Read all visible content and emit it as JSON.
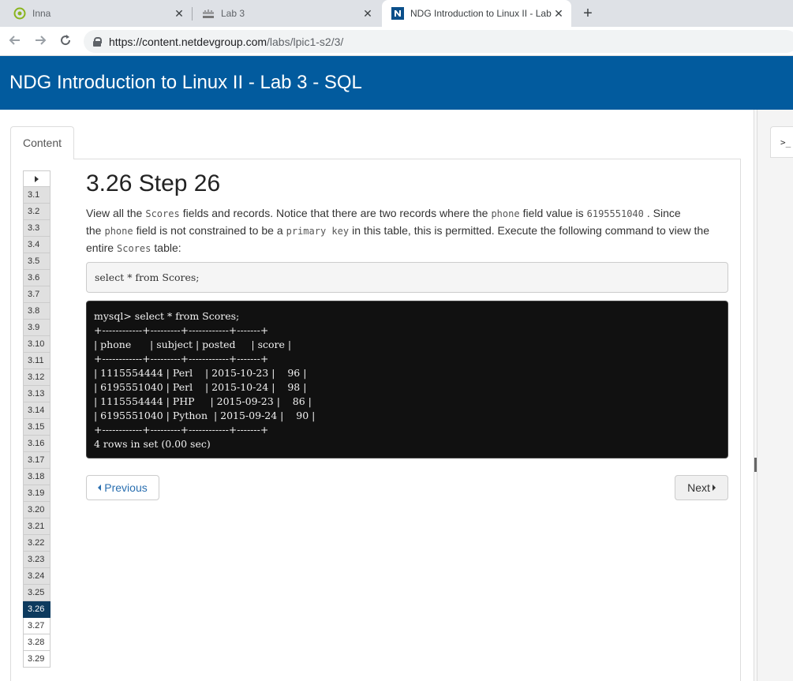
{
  "browser": {
    "tabs": [
      {
        "title": "Inna",
        "icon": "circle-target-icon"
      },
      {
        "title": "Lab 3",
        "icon": "cisco-icon"
      },
      {
        "title": "NDG Introduction to Linux II - Lab",
        "icon": "ndg-n-icon",
        "active": true
      }
    ],
    "close_glyph": "✕",
    "new_tab_glyph": "+",
    "url_host": "https://content.netdevgroup.com",
    "url_path": "/labs/lpic1-s2/3/"
  },
  "header": {
    "title": "NDG Introduction to Linux II - Lab 3 - SQL"
  },
  "content_tab_label": "Content",
  "terminal_tab_label": ">_",
  "steps": [
    "3.1",
    "3.2",
    "3.3",
    "3.4",
    "3.5",
    "3.6",
    "3.7",
    "3.8",
    "3.9",
    "3.10",
    "3.11",
    "3.12",
    "3.13",
    "3.14",
    "3.15",
    "3.16",
    "3.17",
    "3.18",
    "3.19",
    "3.20",
    "3.21",
    "3.22",
    "3.23",
    "3.24",
    "3.25",
    "3.26",
    "3.27",
    "3.28",
    "3.29"
  ],
  "active_step": "3.26",
  "step": {
    "title": "3.26 Step 26",
    "text": {
      "p1": "View all the",
      "c1": "Scores",
      "p2": "fields and records. Notice that there are two records where the",
      "c2": "phone",
      "p3": "field value is",
      "c3": "6195551040",
      "p4": ". Since the",
      "c4": "phone",
      "p5": "field is not constrained to be a",
      "c5": "primary key",
      "p6": "in this table, this is permitted. Execute the following command to view the entire",
      "c6": "Scores",
      "p7": "table:"
    },
    "command": "select * from Scores;",
    "terminal_output": "mysql> select * from Scores;\n+------------+---------+------------+-------+\n| phone      | subject | posted     | score |\n+------------+---------+------------+-------+\n| 1115554444 | Perl    | 2015-10-23 |    96 |\n| 6195551040 | Perl    | 2015-10-24 |    98 |\n| 1115554444 | PHP     | 2015-09-23 |    86 |\n| 6195551040 | Python  | 2015-09-24 |    90 |\n+------------+---------+------------+-------+\n4 rows in set (0.00 sec)"
  },
  "buttons": {
    "previous": "Previous",
    "next": "Next"
  },
  "colors": {
    "header_bg": "#025b9e",
    "active_step_bg": "#0d3a5e",
    "terminal_bg": "#111111"
  }
}
